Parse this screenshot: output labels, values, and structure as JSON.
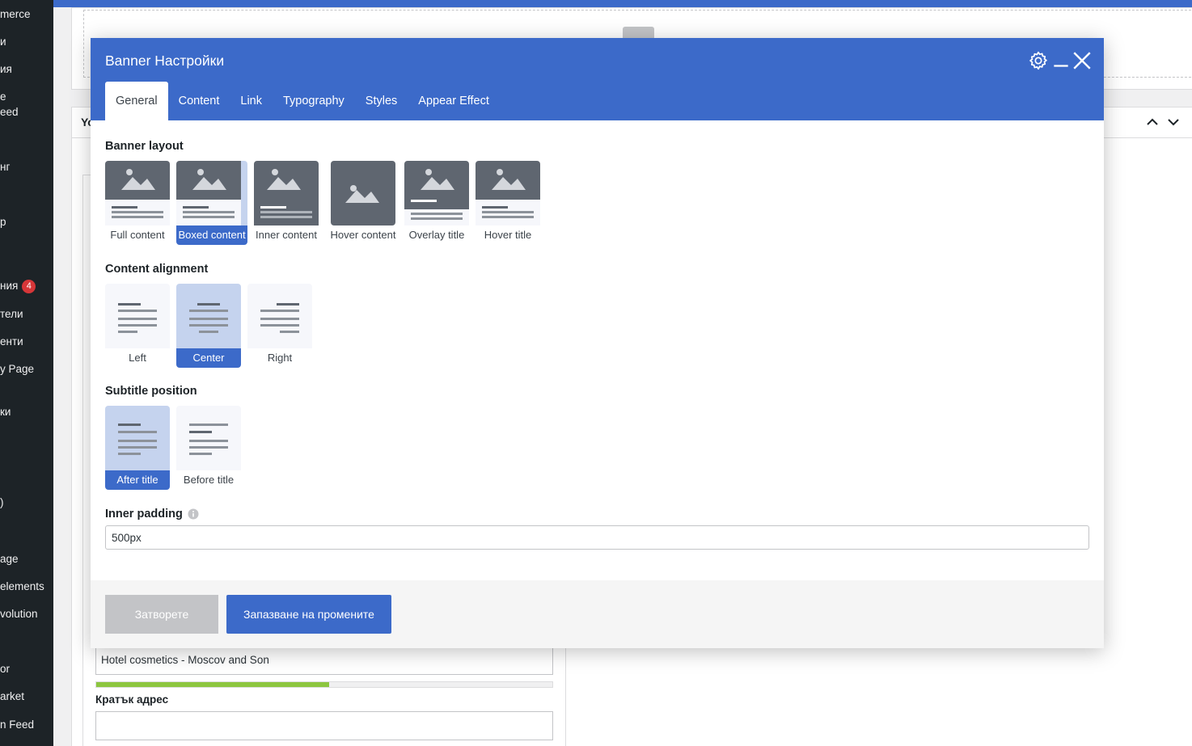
{
  "admin_menu": {
    "items": [
      {
        "label": "merce"
      },
      {
        "label": "и"
      },
      {
        "label": "ия"
      },
      {
        "label": "е\need"
      },
      {
        "label": "нг"
      },
      {
        "label": "р"
      },
      {
        "label": "ния",
        "badge": "4"
      },
      {
        "label": "тели"
      },
      {
        "label": "енти"
      },
      {
        "label": "y Page"
      },
      {
        "label": "ки"
      },
      {
        "label": ")"
      },
      {
        "label": "age"
      },
      {
        "label": "elements"
      },
      {
        "label": "volution"
      },
      {
        "label": "or"
      },
      {
        "label": "arket"
      },
      {
        "label": "n Feed"
      }
    ]
  },
  "background_page": {
    "panel_title": "Yo",
    "title_input_value": "Hotel cosmetics - Moscov and Son",
    "seo_progress": 0.51,
    "short_address_label": "Кратък адрес"
  },
  "modal": {
    "title": "Banner Настройки",
    "tabs": [
      {
        "label": "General",
        "active": true
      },
      {
        "label": "Content"
      },
      {
        "label": "Link"
      },
      {
        "label": "Typography"
      },
      {
        "label": "Styles"
      },
      {
        "label": "Appear Effect"
      }
    ],
    "banner_layout": {
      "label": "Banner layout",
      "options": [
        "Full content",
        "Boxed content",
        "Inner content",
        "Hover content",
        "Overlay title",
        "Hover title"
      ],
      "selected": "Boxed content"
    },
    "content_alignment": {
      "label": "Content alignment",
      "options": [
        "Left",
        "Center",
        "Right"
      ],
      "selected": "Center"
    },
    "subtitle_position": {
      "label": "Subtitle position",
      "options": [
        "After title",
        "Before title"
      ],
      "selected": "After title"
    },
    "inner_padding": {
      "label": "Inner padding",
      "value": "500px"
    },
    "footer": {
      "close_label": "Затворете",
      "save_label": "Запазване на промените"
    }
  },
  "colors": {
    "accent": "#3c6ac9",
    "selected_bg": "#c5d3ee",
    "admin_menu_bg": "#1d2327",
    "progress_fill": "#8cc63f"
  }
}
